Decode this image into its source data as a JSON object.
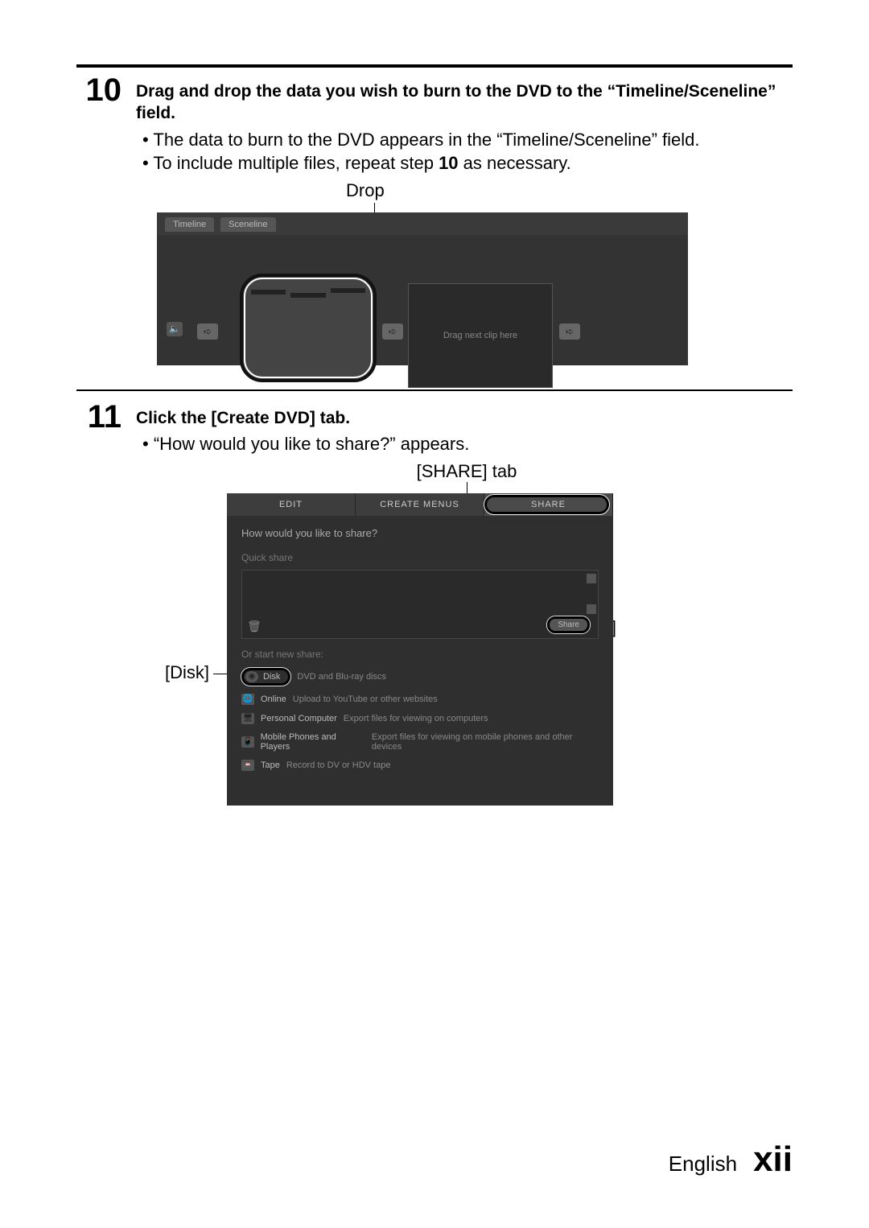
{
  "step10": {
    "number": "10",
    "title_a": "Drag and drop the data you wish to burn to the DVD to the “Timeline/Sceneline” field.",
    "bullet1": "The data to burn to the DVD appears in the “Timeline/Sceneline” field.",
    "bullet2_a": "To include multiple files, repeat step ",
    "bullet2_b": "10",
    "bullet2_c": " as necessary.",
    "drop_label": "Drop",
    "tl_tab1": "Timeline",
    "tl_tab2": "Sceneline",
    "drag_placeholder": "Drag next clip here"
  },
  "step11": {
    "number": "11",
    "title": "Click the [Create DVD] tab.",
    "bullet1": "“How would you like to share?” appears.",
    "share_tab_label": "[SHARE] tab",
    "callout_disk": "[Disk]",
    "callout_share": "[Share]"
  },
  "panel": {
    "tab_edit": "EDIT",
    "tab_menus": "CREATE MENUS",
    "tab_share": "SHARE",
    "question": "How would you like to share?",
    "quick_share": "Quick share",
    "share_btn": "Share",
    "or_label": "Or start new share:",
    "opts": {
      "disk": {
        "name": "Disk",
        "desc": "DVD and Blu-ray discs"
      },
      "online": {
        "name": "Online",
        "desc": "Upload to YouTube or other websites"
      },
      "pc": {
        "name": "Personal Computer",
        "desc": "Export files for viewing on computers"
      },
      "mobile": {
        "name": "Mobile Phones and Players",
        "desc": "Export files for viewing on mobile phones and other devices"
      },
      "tape": {
        "name": "Tape",
        "desc": "Record to DV or HDV tape"
      }
    }
  },
  "footer": {
    "lang": "English",
    "page": "xii"
  }
}
